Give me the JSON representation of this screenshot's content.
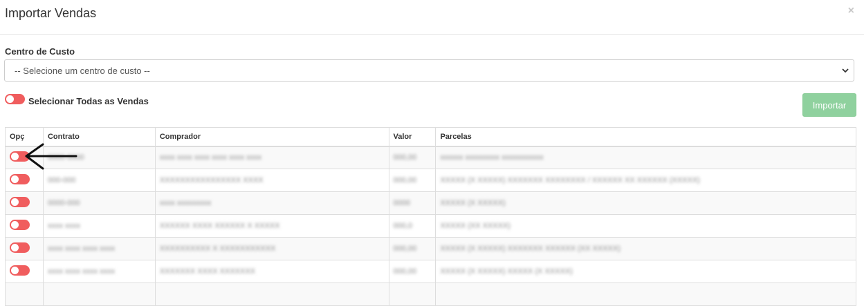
{
  "modal": {
    "title": "Importar Vendas",
    "close_label": "×"
  },
  "cost_center": {
    "label": "Centro de Custo",
    "selected": "-- Selecione um centro de custo --"
  },
  "select_all": {
    "label": "Selecionar Todas as Vendas",
    "enabled": false
  },
  "import_button": {
    "label": "Importar"
  },
  "table": {
    "headers": [
      "Opç",
      "Contrato",
      "Comprador",
      "Valor",
      "Parcelas"
    ],
    "rows": [
      {
        "contrato": "0000-0000",
        "comprador": "xxxx xxxx xxxx xxxx xxxx xxxx",
        "valor": "000,00",
        "parcelas": "xxxxxx xxxxxxxxx xxxxxxxxxxx"
      },
      {
        "contrato": "000-000",
        "comprador": "XXXXXXXXXXXXXXXX XXXX",
        "valor": "000,00",
        "parcelas": "XXXXX (X XXXXX) XXXXXXX XXXXXXXX / XXXXXX XX XXXXXX (XXXXX)"
      },
      {
        "contrato": "0000-000",
        "comprador": "xxxx xxxxxxxxx",
        "valor": "0000",
        "parcelas": "XXXXX (X XXXXX)"
      },
      {
        "contrato": "xxxx xxxx",
        "comprador": "XXXXXX XXXX XXXXXX X XXXXX",
        "valor": "000,0",
        "parcelas": "XXXXX (XX XXXXX)"
      },
      {
        "contrato": "xxxx xxxx xxxx xxxx",
        "comprador": "XXXXXXXXXX X XXXXXXXXXXX",
        "valor": "000,00",
        "parcelas": "XXXXX (X XXXXX) XXXXXXX XXXXXX (XX XXXXX)"
      },
      {
        "contrato": "xxxx xxxx xxxx xxxx",
        "comprador": "XXXXXXX XXXX XXXXXXX",
        "valor": "000,00",
        "parcelas": "XXXXX (X XXXXX) XXXXX (X XXXXX)"
      },
      {
        "contrato": "",
        "comprador": "",
        "valor": "",
        "parcelas": ""
      }
    ]
  },
  "colors": {
    "toggle_off": "#f05d5e",
    "import_button": "#8fd19e"
  }
}
